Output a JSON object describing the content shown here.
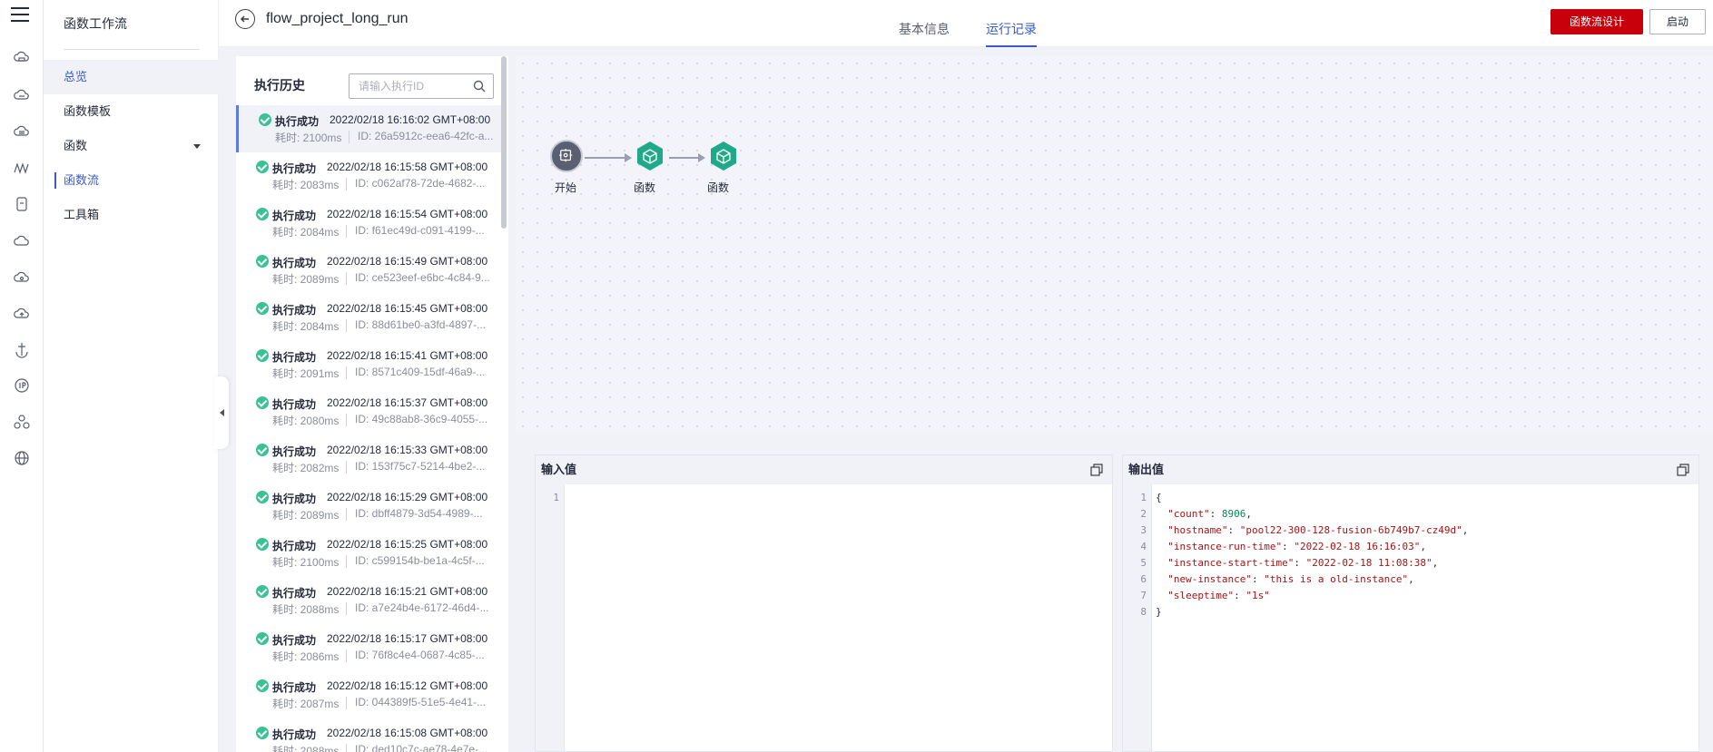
{
  "rail": {
    "icons": [
      "menu-icon",
      "cloud-server-icon",
      "cloud-icon",
      "cloud-database-icon",
      "wave-icon",
      "storage-icon",
      "cloud-outline-icon",
      "cloud-gear-icon",
      "cloud-up-icon",
      "anchor-icon",
      "ip-icon",
      "cluster-icon",
      "globe-icon"
    ]
  },
  "nav": {
    "title": "函数工作流",
    "items": [
      {
        "label": "总览"
      },
      {
        "label": "函数模板"
      },
      {
        "label": "函数"
      },
      {
        "label": "函数流"
      },
      {
        "label": "工具箱"
      }
    ]
  },
  "header": {
    "project": "flow_project_long_run",
    "tabs": [
      {
        "label": "基本信息"
      },
      {
        "label": "运行记录"
      }
    ],
    "design_button": "函数流设计",
    "start_button": "启动"
  },
  "history": {
    "title": "执行历史",
    "search_placeholder": "请输入执行ID",
    "records": [
      {
        "status": "执行成功",
        "time": "2022/02/18 16:16:02 GMT+08:00",
        "duration": "耗时: 2100ms",
        "id": "ID: 26a5912c-eea6-42fc-a..."
      },
      {
        "status": "执行成功",
        "time": "2022/02/18 16:15:58 GMT+08:00",
        "duration": "耗时: 2083ms",
        "id": "ID: c062af78-72de-4682-..."
      },
      {
        "status": "执行成功",
        "time": "2022/02/18 16:15:54 GMT+08:00",
        "duration": "耗时: 2084ms",
        "id": "ID: f61ec49d-c091-4199-..."
      },
      {
        "status": "执行成功",
        "time": "2022/02/18 16:15:49 GMT+08:00",
        "duration": "耗时: 2089ms",
        "id": "ID: ce523eef-e6bc-4c84-9..."
      },
      {
        "status": "执行成功",
        "time": "2022/02/18 16:15:45 GMT+08:00",
        "duration": "耗时: 2084ms",
        "id": "ID: 88d61be0-a3fd-4897-..."
      },
      {
        "status": "执行成功",
        "time": "2022/02/18 16:15:41 GMT+08:00",
        "duration": "耗时: 2091ms",
        "id": "ID: 8571c409-15df-46a9-..."
      },
      {
        "status": "执行成功",
        "time": "2022/02/18 16:15:37 GMT+08:00",
        "duration": "耗时: 2080ms",
        "id": "ID: 49c88ab8-36c9-4055-..."
      },
      {
        "status": "执行成功",
        "time": "2022/02/18 16:15:33 GMT+08:00",
        "duration": "耗时: 2082ms",
        "id": "ID: 153f75c7-5214-4be2-..."
      },
      {
        "status": "执行成功",
        "time": "2022/02/18 16:15:29 GMT+08:00",
        "duration": "耗时: 2089ms",
        "id": "ID: dbff4879-3d54-4989-..."
      },
      {
        "status": "执行成功",
        "time": "2022/02/18 16:15:25 GMT+08:00",
        "duration": "耗时: 2100ms",
        "id": "ID: c599154b-be1a-4c5f-..."
      },
      {
        "status": "执行成功",
        "time": "2022/02/18 16:15:21 GMT+08:00",
        "duration": "耗时: 2088ms",
        "id": "ID: a7e24b4e-6172-46d4-..."
      },
      {
        "status": "执行成功",
        "time": "2022/02/18 16:15:17 GMT+08:00",
        "duration": "耗时: 2086ms",
        "id": "ID: 76f8c4e4-0687-4c85-..."
      },
      {
        "status": "执行成功",
        "time": "2022/02/18 16:15:12 GMT+08:00",
        "duration": "耗时: 2087ms",
        "id": "ID: 044389f5-51e5-4e41-..."
      },
      {
        "status": "执行成功",
        "time": "2022/02/18 16:15:08 GMT+08:00",
        "duration": "耗时: 2088ms",
        "id": "ID: ded10c7c-ae78-4e7e-..."
      }
    ]
  },
  "flow": {
    "nodes": [
      {
        "label": "开始",
        "icon": "start-node-icon"
      },
      {
        "label": "函数",
        "icon": "function-node-icon"
      },
      {
        "label": "函数",
        "icon": "function-node-icon"
      }
    ]
  },
  "input_panel": {
    "title": "输入值",
    "lines": [
      "1"
    ]
  },
  "output_panel": {
    "title": "输出值",
    "lines": [
      {
        "n": "1",
        "text": "{"
      },
      {
        "n": "2",
        "key": "\"count\"",
        "sep": ": ",
        "val": "8906",
        "end": ","
      },
      {
        "n": "3",
        "key": "\"hostname\"",
        "sep": ": ",
        "val": "\"pool22-300-128-fusion-6b749b7-cz49d\"",
        "end": ","
      },
      {
        "n": "4",
        "key": "\"instance-run-time\"",
        "sep": ": ",
        "val": "\"2022-02-18 16:16:03\"",
        "end": ","
      },
      {
        "n": "5",
        "key": "\"instance-start-time\"",
        "sep": ": ",
        "val": "\"2022-02-18 11:08:38\"",
        "end": ","
      },
      {
        "n": "6",
        "key": "\"new-instance\"",
        "sep": ": ",
        "val": "\"this is a old-instance\"",
        "end": ","
      },
      {
        "n": "7",
        "key": "\"sleeptime\"",
        "sep": ": ",
        "val": "\"1s\"",
        "end": ""
      },
      {
        "n": "8",
        "text": "}"
      }
    ]
  },
  "colors": {
    "accent": "#3a5bcc",
    "brand_red": "#c7000b",
    "success": "#3ac295",
    "node_teal": "#1fa989"
  }
}
